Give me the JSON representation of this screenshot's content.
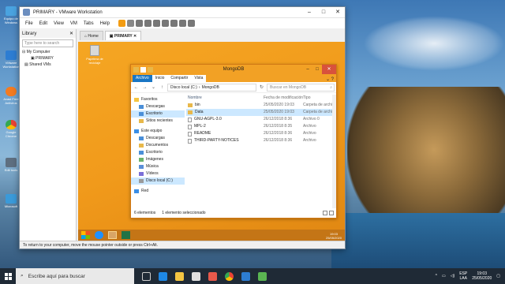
{
  "host_desktop": {
    "icons": [
      {
        "label": "Equipo de Windows"
      },
      {
        "label": "VMware Workstation"
      },
      {
        "label": "Avast Free Antivirus"
      },
      {
        "label": "Google Chrome"
      },
      {
        "label": "Edit tools"
      },
      {
        "label": "Microsoft"
      }
    ]
  },
  "vmware": {
    "title": "PRIMARY - VMware Workstation",
    "menus": [
      "File",
      "Edit",
      "View",
      "VM",
      "Tabs",
      "Help"
    ],
    "library": {
      "title": "Library",
      "search_placeholder": "Type here to search",
      "tree": [
        {
          "label": "My Computer"
        },
        {
          "label": "PRIMARY"
        },
        {
          "label": "Shared VMs"
        }
      ]
    },
    "tabs": [
      {
        "label": "Home"
      },
      {
        "label": "PRIMARY"
      }
    ],
    "status": "To return to your computer, move the mouse pointer outside or press Ctrl+Alt."
  },
  "guest": {
    "recycle_label": "Papelera de reciclaje",
    "clock_time": "19:03",
    "clock_date": "25/05/2020"
  },
  "explorer": {
    "title": "MongoDB",
    "ribbon_tabs": [
      "Archivo",
      "Inicio",
      "Compartir",
      "Vista"
    ],
    "address": [
      "Disco local (C:)",
      "MongoDB"
    ],
    "search_placeholder": "Buscar en MongoDB",
    "nav": {
      "quick_access": "Favoritos",
      "quick_items": [
        "Descargas",
        "Escritorio",
        "Sitios recientes"
      ],
      "this_pc": "Este equipo",
      "pc_items": [
        "Descargas",
        "Documentos",
        "Escritorio",
        "Imágenes",
        "Música",
        "Vídeos",
        "Disco local (C:)"
      ],
      "network": "Red"
    },
    "columns": {
      "name": "Nombre",
      "date": "Fecha de modificación",
      "type": "Tipo"
    },
    "files": [
      {
        "name": "bin",
        "date": "25/05/2020 19:03",
        "type": "Carpeta de archivos",
        "kind": "folder"
      },
      {
        "name": "Data",
        "date": "25/05/2020 19:03",
        "type": "Carpeta de archivos",
        "kind": "folder"
      },
      {
        "name": "GNU-AGPL-3.0",
        "date": "26/12/2018 8:36",
        "type": "Archivo 0",
        "kind": "file"
      },
      {
        "name": "MPL-2",
        "date": "26/12/2018 8:35",
        "type": "Archivo",
        "kind": "file"
      },
      {
        "name": "README",
        "date": "26/12/2018 8:36",
        "type": "Archivo",
        "kind": "file"
      },
      {
        "name": "THIRD-PARTY-NOTICES",
        "date": "26/12/2018 8:36",
        "type": "Archivo",
        "kind": "file"
      }
    ],
    "status_count": "6 elementos",
    "status_selected": "1 elemento seleccionado"
  },
  "host_taskbar": {
    "search_placeholder": "Escribe aquí para buscar",
    "lang": "ESP",
    "lang2": "LAA",
    "time": "19:03",
    "date": "25/05/2020"
  }
}
